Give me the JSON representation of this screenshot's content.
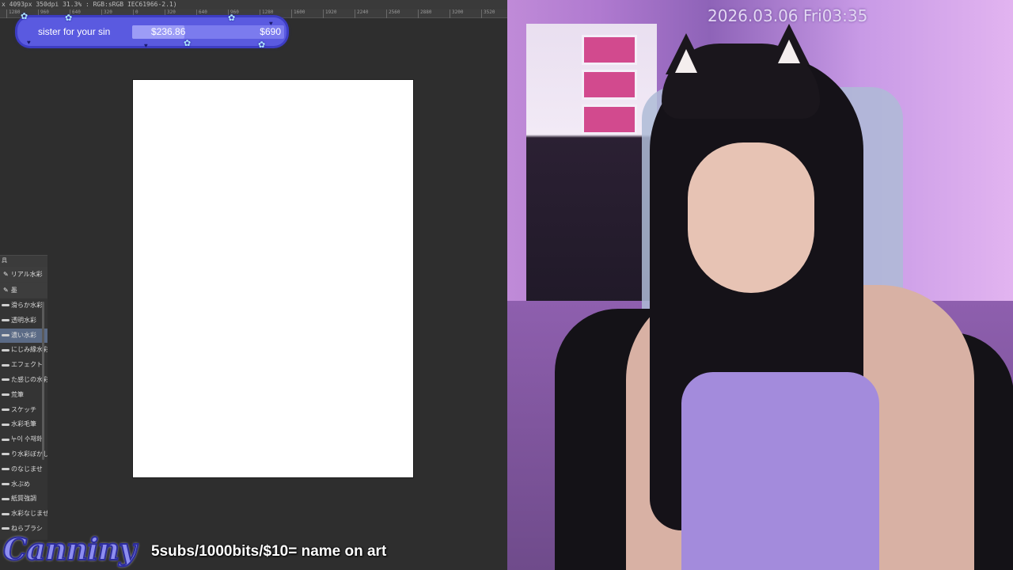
{
  "app": {
    "status_text": "x 4093px 350dpi 31.3% : RGB:sRGB IEC61966-2.1)",
    "ruler_ticks": [
      "1280",
      "960",
      "640",
      "320",
      "0",
      "320",
      "640",
      "960",
      "1280",
      "1600",
      "1920",
      "2240",
      "2560",
      "2880",
      "3200",
      "3520"
    ],
    "brush_panel": {
      "header": "具",
      "categories": [
        {
          "label": "リアル水彩",
          "icon": "pen-icon"
        },
        {
          "label": "墨",
          "icon": "pen-icon"
        }
      ],
      "items": [
        {
          "label": "滑らか水彩",
          "selected": false
        },
        {
          "label": "透明水彩",
          "selected": false
        },
        {
          "label": "濃い水彩",
          "selected": true
        },
        {
          "label": "にじみ縁水彩",
          "selected": false
        },
        {
          "label": "エフェクト",
          "selected": false
        },
        {
          "label": "た感じの水彩",
          "selected": false
        },
        {
          "label": "荒筆",
          "selected": false
        },
        {
          "label": "スケッチ",
          "selected": false
        },
        {
          "label": "水彩毛筆",
          "selected": false
        },
        {
          "label": "누이 수채화",
          "selected": false
        },
        {
          "label": "り水彩ぼかし",
          "selected": false
        },
        {
          "label": "のなじませ",
          "selected": false
        },
        {
          "label": "水ぶめ",
          "selected": false
        },
        {
          "label": "紙質強調",
          "selected": false
        },
        {
          "label": "水彩なじませ",
          "selected": false
        },
        {
          "label": "ねらブラシ",
          "selected": false
        }
      ]
    }
  },
  "goal": {
    "label": "sister for your sin",
    "current": "$236.86",
    "target": "$690",
    "progress": 0.343,
    "colors": {
      "frame": "#5a5ae0",
      "fill": "#9c9cf6"
    }
  },
  "overlay": {
    "logo_text": "Canniny",
    "ticker": "5subs/1000bits/$10= name on art"
  },
  "cam": {
    "clock": "2026.03.06 Fri03:35"
  }
}
